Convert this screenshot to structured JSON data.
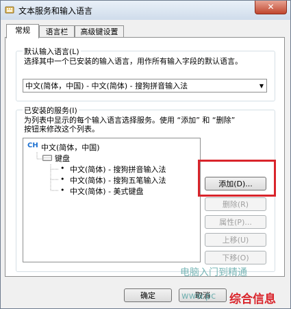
{
  "window": {
    "title": "文本服务和输入语言",
    "close_label": "✕"
  },
  "tabs": [
    {
      "label": "常规"
    },
    {
      "label": "语言栏"
    },
    {
      "label": "高级键设置"
    }
  ],
  "default_language": {
    "group_label": "默认输入语言(L)",
    "description": "选择其中一个已安装的输入语言，用作所有输入字段的默认语言。",
    "selected": "中文(简体，中国) - 中文(简体) - 搜狗拼音输入法"
  },
  "installed_services": {
    "group_label": "已安装的服务(I)",
    "description_line1": "为列表中显示的每个输入语言选择服务。使用 “添加” 和 “删除”",
    "description_line2": "按钮来修改这个列表。",
    "tree": {
      "language_code": "CH",
      "language": "中文(简体，中国)",
      "category": "键盘",
      "items": [
        "中文(简体) - 搜狗拼音输入法",
        "中文(简体) - 搜狗五笔输入法",
        "中文(简体) - 美式键盘"
      ]
    },
    "buttons": {
      "add": "添加(D)...",
      "remove": "删除(R)",
      "properties": "属性(P)...",
      "move_up": "上移(U)",
      "move_down": "下移(O)"
    }
  },
  "footer": {
    "ok": "确定",
    "cancel": "取消"
  },
  "watermark": {
    "line1": "电脑入门到精通",
    "line2": "www.pc",
    "line3": "综合信息"
  }
}
